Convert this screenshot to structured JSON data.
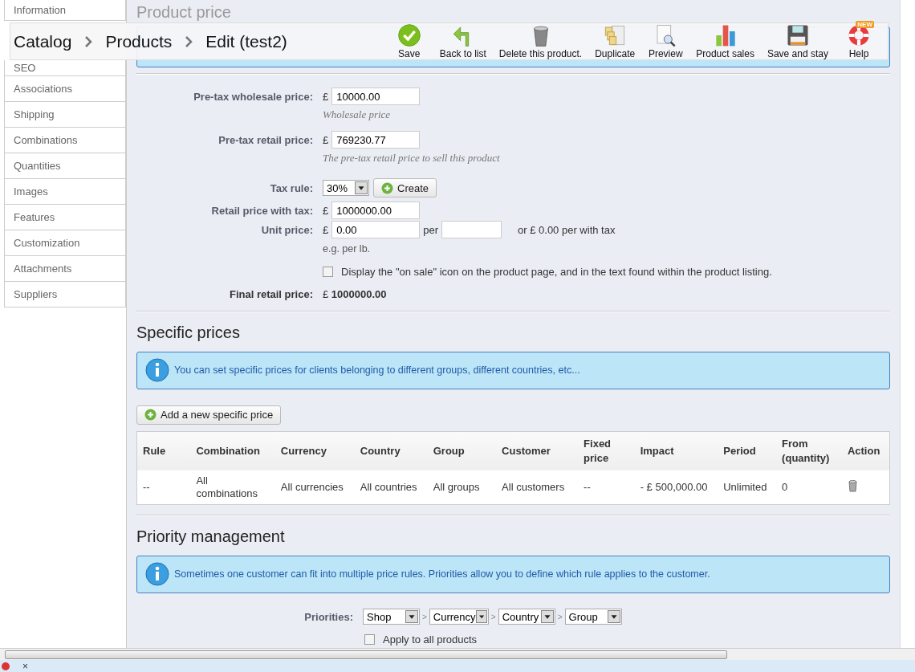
{
  "toolbar": {
    "breadcrumb": [
      "Catalog",
      "Products",
      "Edit (test2)"
    ],
    "buttons": [
      {
        "label": "Save",
        "kind": "save"
      },
      {
        "label": "Back to list",
        "kind": "back"
      },
      {
        "label": "Delete this product.",
        "kind": "delete"
      },
      {
        "label": "Duplicate",
        "kind": "duplicate"
      },
      {
        "label": "Preview",
        "kind": "preview"
      },
      {
        "label": "Product sales",
        "kind": "sales"
      },
      {
        "label": "Save and stay",
        "kind": "stay"
      },
      {
        "label": "Help",
        "kind": "help",
        "badge": "NEW"
      }
    ]
  },
  "sidebar": {
    "items": [
      "Information",
      "SEO",
      "Associations",
      "Shipping",
      "Combinations",
      "Quantities",
      "Images",
      "Features",
      "Customization",
      "Attachments",
      "Suppliers"
    ]
  },
  "product_price": {
    "title": "Product price",
    "fields": [
      {
        "kind": "money",
        "label": "Pre-tax wholesale price:",
        "currency": "£",
        "value": "10000.00",
        "hint": "Wholesale price"
      },
      {
        "kind": "money",
        "label": "Pre-tax retail price:",
        "currency": "£",
        "value": "769230.77",
        "hint": "The pre-tax retail price to sell this product"
      },
      {
        "kind": "select",
        "label": "Tax rule:",
        "value": "30%",
        "button": "Create"
      },
      {
        "kind": "money",
        "label": "Retail price with tax:",
        "currency": "£",
        "value": "1000000.00"
      },
      {
        "kind": "unit",
        "label": "Unit price:",
        "currency": "£",
        "value": "0.00",
        "per": "per",
        "with_tax": "or £ 0.00 per with tax",
        "hint": "e.g. per lb."
      },
      {
        "kind": "checkbox",
        "text": "Display the \"on sale\" icon on the product page, and in the text found within the product listing.",
        "checked": false
      },
      {
        "kind": "total",
        "label": "Final retail price:",
        "currency": "£",
        "value": "1000000.00"
      }
    ]
  },
  "specific_prices": {
    "title": "Specific prices",
    "notice": "You can set specific prices for clients belonging to different groups, different countries, etc...",
    "add_button": "Add a new specific price",
    "table": {
      "columns": [
        "Rule",
        "Combination",
        "Currency",
        "Country",
        "Group",
        "Customer",
        "Fixed price",
        "Impact",
        "Period",
        "From (quantity)",
        "Action"
      ],
      "rows": [
        [
          "--",
          "All combinations",
          "All currencies",
          "All countries",
          "All groups",
          "All customers",
          "--",
          "- £ 500,000.00",
          "Unlimited",
          "0"
        ]
      ]
    }
  },
  "priority_management": {
    "title": "Priority management",
    "notice": "Sometimes one customer can fit into multiple price rules. Priorities allow you to define which rule applies to the customer.",
    "label": "Priorities:",
    "separator": ">",
    "priorities": [
      "Shop",
      "Currency",
      "Country",
      "Group"
    ],
    "apply_all": {
      "label": "Apply to all products",
      "checked": false
    }
  },
  "status_bar": {
    "close": "×"
  }
}
